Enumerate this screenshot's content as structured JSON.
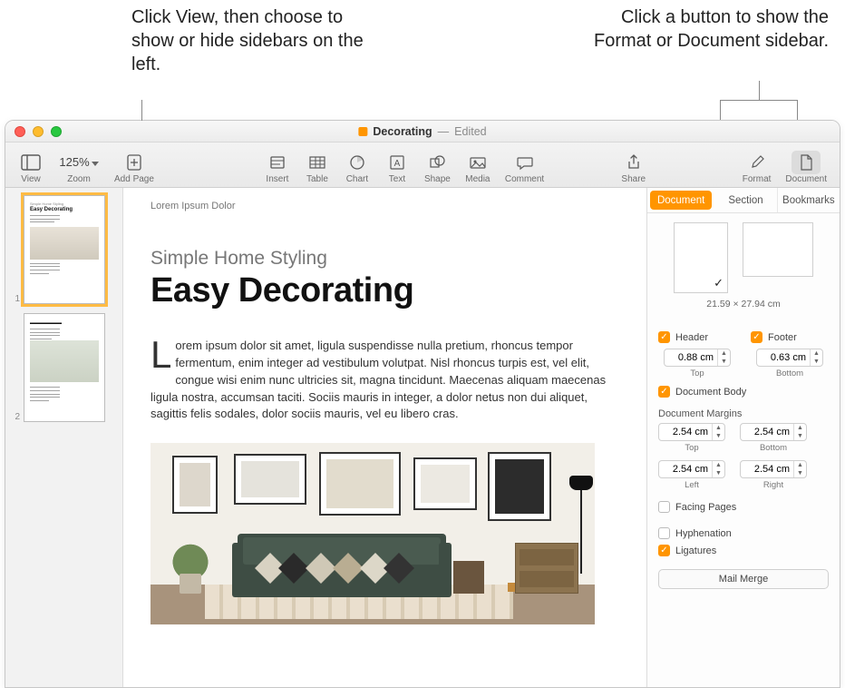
{
  "callouts": {
    "left": "Click View, then choose to show or hide sidebars on the left.",
    "right": "Click a button to show the Format or Document sidebar."
  },
  "titlebar": {
    "doc_name": "Decorating",
    "edited": "Edited",
    "separator": "—"
  },
  "toolbar": {
    "view": "View",
    "zoom": "Zoom",
    "zoom_value": "125%",
    "add_page": "Add Page",
    "insert": "Insert",
    "table": "Table",
    "chart": "Chart",
    "text": "Text",
    "shape": "Shape",
    "media": "Media",
    "comment": "Comment",
    "share": "Share",
    "format": "Format",
    "document": "Document"
  },
  "thumbnails": {
    "page1_num": "1",
    "page2_num": "2",
    "p1_sub": "Simple Home Styling",
    "p1_title": "Easy Decorating"
  },
  "canvas": {
    "header": "Lorem Ipsum Dolor",
    "subheading": "Simple Home Styling",
    "title": "Easy Decorating",
    "body": "Lorem ipsum dolor sit amet, ligula suspendisse nulla pretium, rhoncus tempor fermentum, enim integer ad vestibulum volutpat. Nisl rhoncus turpis est, vel elit, congue wisi enim nunc ultricies sit, magna tincidunt. Maecenas aliquam maecenas ligula nostra, accumsan taciti. Sociis mauris in integer, a dolor netus non dui aliquet, sagittis felis sodales, dolor sociis mauris, vel eu libero cras."
  },
  "inspector": {
    "tabs": {
      "document": "Document",
      "section": "Section",
      "bookmarks": "Bookmarks"
    },
    "dimensions": "21.59 × 27.94 cm",
    "header_label": "Header",
    "footer_label": "Footer",
    "header_value": "0.88 cm",
    "footer_value": "0.63 cm",
    "top_label": "Top",
    "bottom_label": "Bottom",
    "docbody_label": "Document Body",
    "margins_label": "Document Margins",
    "margin_top": "2.54 cm",
    "margin_bottom": "2.54 cm",
    "margin_left": "2.54 cm",
    "margin_right": "2.54 cm",
    "left_label": "Left",
    "right_label": "Right",
    "facing_label": "Facing Pages",
    "hyphen_label": "Hyphenation",
    "ligatures_label": "Ligatures",
    "mailmerge": "Mail Merge"
  }
}
